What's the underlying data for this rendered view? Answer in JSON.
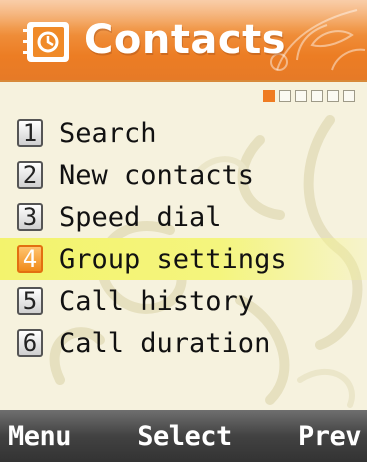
{
  "header": {
    "title": "Contacts",
    "icon": "address-book-icon"
  },
  "page_indicator": {
    "total": 6,
    "current": 1
  },
  "menu": {
    "items": [
      {
        "number": "1",
        "label": "Search"
      },
      {
        "number": "2",
        "label": "New contacts"
      },
      {
        "number": "3",
        "label": "Speed dial"
      },
      {
        "number": "4",
        "label": "Group settings",
        "selected": true
      },
      {
        "number": "5",
        "label": "Call history"
      },
      {
        "number": "6",
        "label": "Call duration"
      }
    ]
  },
  "softkeys": {
    "left": "Menu",
    "center": "Select",
    "right": "Prev"
  },
  "colors": {
    "header_orange": "#ef7c22",
    "highlight_yellow": "#f3f36d",
    "softkey_bar": "#3a3a3a"
  }
}
